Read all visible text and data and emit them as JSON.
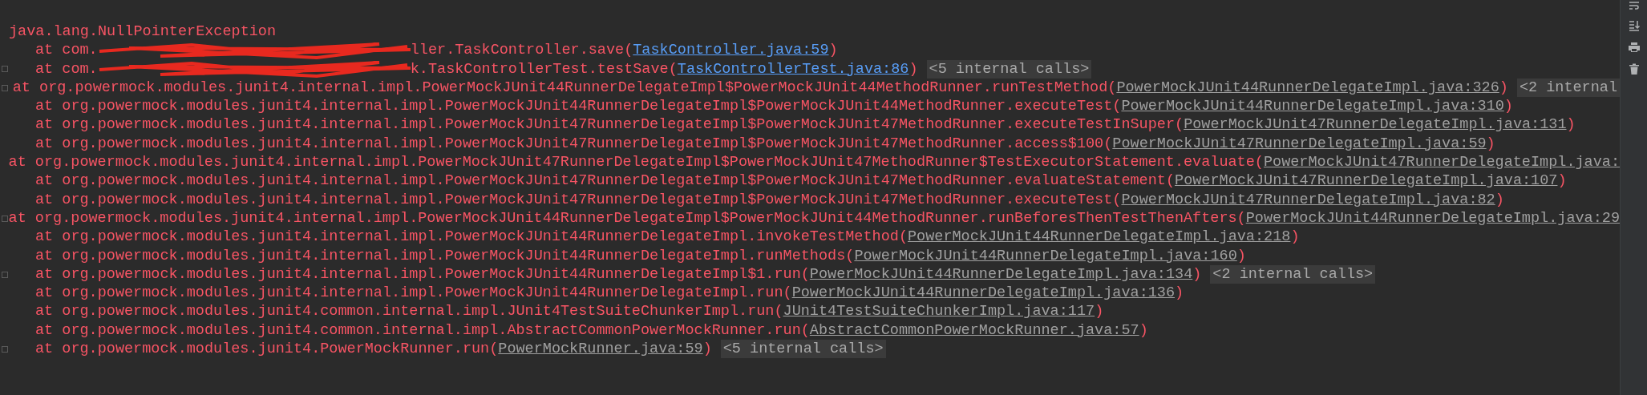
{
  "console": {
    "lines": [
      {
        "kind": "exception",
        "fold_marker": false,
        "segments": [
          {
            "kind": "text",
            "text": "java.lang.NullPointerException"
          }
        ]
      },
      {
        "kind": "frame",
        "fold_marker": false,
        "segments": [
          {
            "kind": "text",
            "text": "at com."
          },
          {
            "kind": "redaction"
          },
          {
            "kind": "text",
            "text": "ller.TaskController.save("
          },
          {
            "kind": "source_link",
            "text": "TaskController.java:59"
          },
          {
            "kind": "text",
            "text": ")"
          }
        ]
      },
      {
        "kind": "frame",
        "fold_marker": true,
        "segments": [
          {
            "kind": "text",
            "text": "at com."
          },
          {
            "kind": "redaction"
          },
          {
            "kind": "text",
            "text": "k.TaskControllerTest.testSave("
          },
          {
            "kind": "source_link",
            "text": "TaskControllerTest.java:86"
          },
          {
            "kind": "text",
            "text": ")"
          },
          {
            "kind": "badge",
            "text": "<5 internal calls>"
          }
        ]
      },
      {
        "kind": "frame",
        "fold_marker": true,
        "segments": [
          {
            "kind": "text",
            "text": "at org.powermock.modules.junit4.internal.impl.PowerMockJUnit44RunnerDelegateImpl$PowerMockJUnit44MethodRunner.runTestMethod("
          },
          {
            "kind": "library_link",
            "text": "PowerMockJUnit44RunnerDelegateImpl.java:326"
          },
          {
            "kind": "text",
            "text": ")"
          },
          {
            "kind": "badge",
            "text": "<2 internal"
          }
        ]
      },
      {
        "kind": "frame",
        "fold_marker": false,
        "segments": [
          {
            "kind": "text",
            "text": "at org.powermock.modules.junit4.internal.impl.PowerMockJUnit44RunnerDelegateImpl$PowerMockJUnit44MethodRunner.executeTest("
          },
          {
            "kind": "library_link",
            "text": "PowerMockJUnit44RunnerDelegateImpl.java:310"
          },
          {
            "kind": "text",
            "text": ")"
          }
        ]
      },
      {
        "kind": "frame",
        "fold_marker": false,
        "segments": [
          {
            "kind": "text",
            "text": "at org.powermock.modules.junit4.internal.impl.PowerMockJUnit47RunnerDelegateImpl$PowerMockJUnit47MethodRunner.executeTestInSuper("
          },
          {
            "kind": "library_link",
            "text": "PowerMockJUnit47RunnerDelegateImpl.java:131"
          },
          {
            "kind": "text",
            "text": ")"
          }
        ]
      },
      {
        "kind": "frame",
        "fold_marker": false,
        "segments": [
          {
            "kind": "text",
            "text": "at org.powermock.modules.junit4.internal.impl.PowerMockJUnit47RunnerDelegateImpl$PowerMockJUnit47MethodRunner.access$100("
          },
          {
            "kind": "library_link",
            "text": "PowerMockJUnit47RunnerDelegateImpl.java:59"
          },
          {
            "kind": "text",
            "text": ")"
          }
        ]
      },
      {
        "kind": "frame",
        "fold_marker": false,
        "segments": [
          {
            "kind": "text",
            "text": "at org.powermock.modules.junit4.internal.impl.PowerMockJUnit47RunnerDelegateImpl$PowerMockJUnit47MethodRunner$TestExecutorStatement.evaluate("
          },
          {
            "kind": "library_link",
            "text": "PowerMockJUnit47RunnerDelegateImpl.java:"
          }
        ]
      },
      {
        "kind": "frame",
        "fold_marker": false,
        "segments": [
          {
            "kind": "text",
            "text": "at org.powermock.modules.junit4.internal.impl.PowerMockJUnit47RunnerDelegateImpl$PowerMockJUnit47MethodRunner.evaluateStatement("
          },
          {
            "kind": "library_link",
            "text": "PowerMockJUnit47RunnerDelegateImpl.java:107"
          },
          {
            "kind": "text",
            "text": ")"
          }
        ]
      },
      {
        "kind": "frame",
        "fold_marker": false,
        "segments": [
          {
            "kind": "text",
            "text": "at org.powermock.modules.junit4.internal.impl.PowerMockJUnit47RunnerDelegateImpl$PowerMockJUnit47MethodRunner.executeTest("
          },
          {
            "kind": "library_link",
            "text": "PowerMockJUnit47RunnerDelegateImpl.java:82"
          },
          {
            "kind": "text",
            "text": ")"
          }
        ]
      },
      {
        "kind": "frame",
        "fold_marker": true,
        "segments": [
          {
            "kind": "text",
            "text": "at org.powermock.modules.junit4.internal.impl.PowerMockJUnit44RunnerDelegateImpl$PowerMockJUnit44MethodRunner.runBeforesThenTestThenAfters("
          },
          {
            "kind": "library_link",
            "text": "PowerMockJUnit44RunnerDelegateImpl.java:29"
          }
        ]
      },
      {
        "kind": "frame",
        "fold_marker": false,
        "segments": [
          {
            "kind": "text",
            "text": "at org.powermock.modules.junit4.internal.impl.PowerMockJUnit44RunnerDelegateImpl.invokeTestMethod("
          },
          {
            "kind": "library_link",
            "text": "PowerMockJUnit44RunnerDelegateImpl.java:218"
          },
          {
            "kind": "text",
            "text": ")"
          }
        ]
      },
      {
        "kind": "frame",
        "fold_marker": false,
        "segments": [
          {
            "kind": "text",
            "text": "at org.powermock.modules.junit4.internal.impl.PowerMockJUnit44RunnerDelegateImpl.runMethods("
          },
          {
            "kind": "library_link",
            "text": "PowerMockJUnit44RunnerDelegateImpl.java:160"
          },
          {
            "kind": "text",
            "text": ")"
          }
        ]
      },
      {
        "kind": "frame",
        "fold_marker": true,
        "segments": [
          {
            "kind": "text",
            "text": "at org.powermock.modules.junit4.internal.impl.PowerMockJUnit44RunnerDelegateImpl$1.run("
          },
          {
            "kind": "library_link",
            "text": "PowerMockJUnit44RunnerDelegateImpl.java:134"
          },
          {
            "kind": "text",
            "text": ")"
          },
          {
            "kind": "badge",
            "text": "<2 internal calls>"
          }
        ]
      },
      {
        "kind": "frame",
        "fold_marker": false,
        "segments": [
          {
            "kind": "text",
            "text": "at org.powermock.modules.junit4.internal.impl.PowerMockJUnit44RunnerDelegateImpl.run("
          },
          {
            "kind": "library_link",
            "text": "PowerMockJUnit44RunnerDelegateImpl.java:136"
          },
          {
            "kind": "text",
            "text": ")"
          }
        ]
      },
      {
        "kind": "frame",
        "fold_marker": false,
        "segments": [
          {
            "kind": "text",
            "text": "at org.powermock.modules.junit4.common.internal.impl.JUnit4TestSuiteChunkerImpl.run("
          },
          {
            "kind": "library_link",
            "text": "JUnit4TestSuiteChunkerImpl.java:117"
          },
          {
            "kind": "text",
            "text": ")"
          }
        ]
      },
      {
        "kind": "frame",
        "fold_marker": false,
        "segments": [
          {
            "kind": "text",
            "text": "at org.powermock.modules.junit4.common.internal.impl.AbstractCommonPowerMockRunner.run("
          },
          {
            "kind": "library_link",
            "text": "AbstractCommonPowerMockRunner.java:57"
          },
          {
            "kind": "text",
            "text": ")"
          }
        ]
      },
      {
        "kind": "frame",
        "fold_marker": true,
        "segments": [
          {
            "kind": "text",
            "text": "at org.powermock.modules.junit4.PowerMockRunner.run("
          },
          {
            "kind": "library_link",
            "text": "PowerMockRunner.java:59"
          },
          {
            "kind": "text",
            "text": ")"
          },
          {
            "kind": "badge",
            "text": "<5 internal calls>"
          }
        ]
      }
    ]
  }
}
